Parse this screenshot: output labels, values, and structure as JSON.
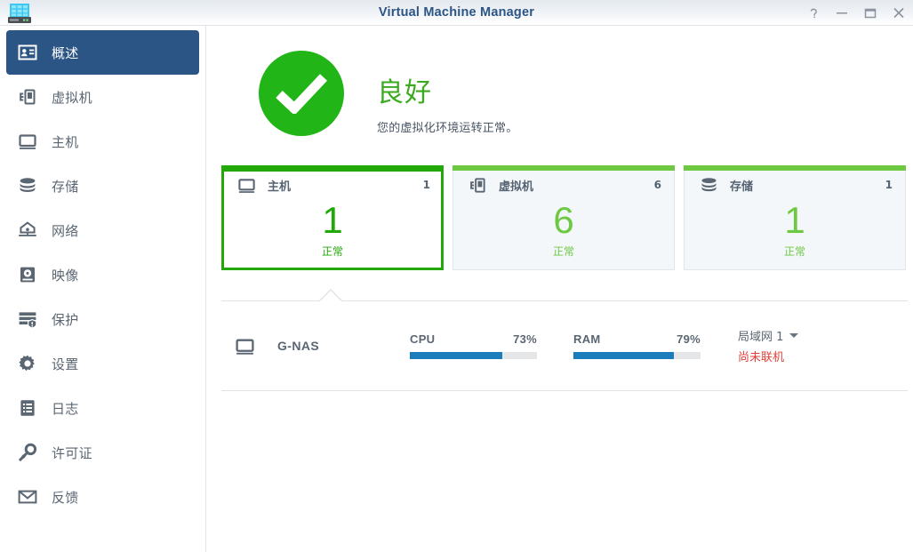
{
  "window": {
    "title": "Virtual Machine Manager",
    "app_icon": "nas-server-icon",
    "controls": [
      {
        "name": "help-button",
        "glyph": "?"
      },
      {
        "name": "minimize-button",
        "glyph": "—"
      },
      {
        "name": "maximize-button",
        "glyph": "□"
      },
      {
        "name": "close-button",
        "glyph": "✕"
      }
    ]
  },
  "sidebar": {
    "items": [
      {
        "label": "概述",
        "icon": "overview-icon",
        "selected": true
      },
      {
        "label": "虚拟机",
        "icon": "virtual-machine-icon",
        "selected": false
      },
      {
        "label": "主机",
        "icon": "host-monitor-icon",
        "selected": false
      },
      {
        "label": "存储",
        "icon": "storage-database-icon",
        "selected": false
      },
      {
        "label": "网络",
        "icon": "network-icon",
        "selected": false
      },
      {
        "label": "映像",
        "icon": "image-disk-icon",
        "selected": false
      },
      {
        "label": "保护",
        "icon": "protection-shield-icon",
        "selected": false
      },
      {
        "label": "设置",
        "icon": "gear-icon",
        "selected": false
      },
      {
        "label": "日志",
        "icon": "log-document-icon",
        "selected": false
      },
      {
        "label": "许可证",
        "icon": "license-key-icon",
        "selected": false
      },
      {
        "label": "反馈",
        "icon": "feedback-envelope-icon",
        "selected": false
      }
    ]
  },
  "main": {
    "hero": {
      "icon": "check-circle-icon",
      "title": "良好",
      "subtitle": "您的虚拟化环境运转正常。",
      "color": "#21b518"
    },
    "cards": [
      {
        "icon": "host-monitor-icon",
        "title": "主机",
        "count": "1",
        "big": "1",
        "status": "正常",
        "selected": true,
        "accent": "#22a808"
      },
      {
        "icon": "virtual-machine-icon",
        "title": "虚拟机",
        "count": "6",
        "big": "6",
        "status": "正常",
        "selected": false,
        "accent": "#6dc942"
      },
      {
        "icon": "storage-database-icon",
        "title": "存储",
        "count": "1",
        "big": "1",
        "status": "正常",
        "selected": false,
        "accent": "#6dc942"
      }
    ],
    "detail": {
      "host_icon": "host-monitor-icon",
      "host_name": "G-NAS",
      "meters": [
        {
          "label": "CPU",
          "value": "73%",
          "percent": 73,
          "color": "#1a7cba"
        },
        {
          "label": "RAM",
          "value": "79%",
          "percent": 79,
          "color": "#1a7cba"
        }
      ],
      "network": {
        "selected": "局域网 1",
        "status": "尚未联机",
        "status_color": "#e0413a"
      }
    }
  }
}
